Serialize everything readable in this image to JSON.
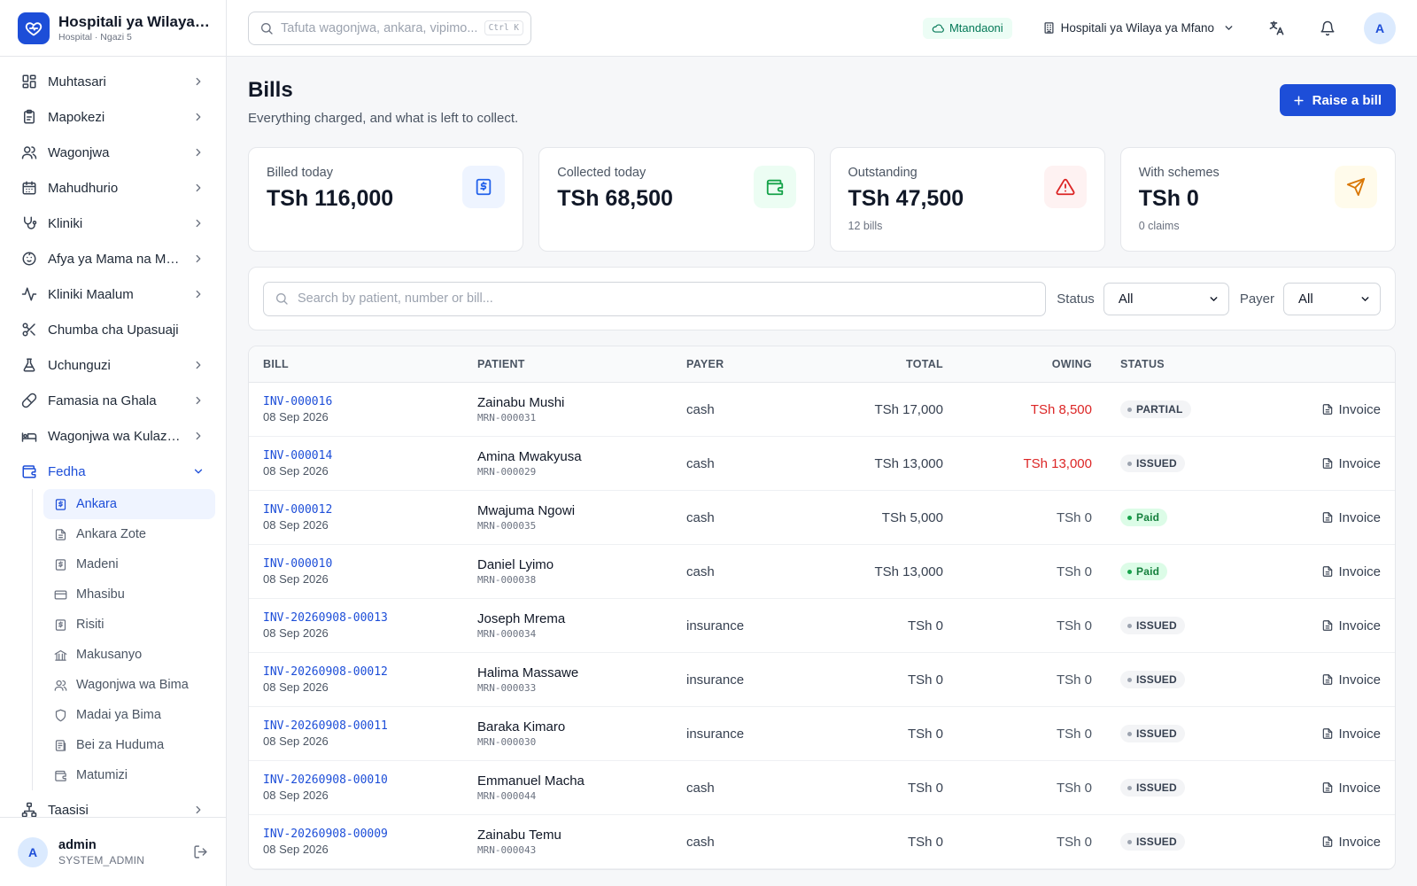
{
  "brand": {
    "name": "Hospitali ya Wilaya ya Mfano",
    "sub": "Hospital · Ngazi 5"
  },
  "nav": {
    "items": [
      {
        "label": "Muhtasari",
        "icon": "dashboard-icon"
      },
      {
        "label": "Mapokezi",
        "icon": "clipboard-icon"
      },
      {
        "label": "Wagonjwa",
        "icon": "users-icon"
      },
      {
        "label": "Mahudhurio",
        "icon": "calendar-icon"
      },
      {
        "label": "Kliniki",
        "icon": "stethoscope-icon"
      },
      {
        "label": "Afya ya Mama na Mtoto",
        "icon": "baby-icon"
      },
      {
        "label": "Kliniki Maalum",
        "icon": "activity-icon"
      },
      {
        "label": "Chumba cha Upasuaji",
        "icon": "scissors-icon"
      },
      {
        "label": "Uchunguzi",
        "icon": "flask-icon"
      },
      {
        "label": "Famasia na Ghala",
        "icon": "pill-icon"
      },
      {
        "label": "Wagonjwa wa Kulazwa",
        "icon": "bed-icon"
      }
    ],
    "finance": {
      "label": "Fedha",
      "icon": "wallet-icon"
    },
    "finance_sub": [
      {
        "label": "Ankara",
        "icon": "receipt-icon"
      },
      {
        "label": "Ankara Zote",
        "icon": "file-icon"
      },
      {
        "label": "Madeni",
        "icon": "receipt-icon"
      },
      {
        "label": "Mhasibu",
        "icon": "card-icon"
      },
      {
        "label": "Risiti",
        "icon": "receipt-icon"
      },
      {
        "label": "Makusanyo",
        "icon": "bank-icon"
      },
      {
        "label": "Wagonjwa wa Bima",
        "icon": "users-icon"
      },
      {
        "label": "Madai ya Bima",
        "icon": "shield-icon"
      },
      {
        "label": "Bei za Huduma",
        "icon": "price-list-icon"
      },
      {
        "label": "Matumizi",
        "icon": "wallet-icon"
      }
    ],
    "after": {
      "label": "Taasisi",
      "icon": "org-icon"
    }
  },
  "user": {
    "initial": "A",
    "name": "admin",
    "role": "SYSTEM_ADMIN"
  },
  "topbar": {
    "search_placeholder": "Tafuta wagonjwa, ankara, vipimo...",
    "shortcut": "Ctrl K",
    "status": "Mtandaoni",
    "facility": "Hospitali ya Wilaya ya Mfano",
    "avatar": "A"
  },
  "page": {
    "title": "Bills",
    "subtitle": "Everything charged, and what is left to collect.",
    "action": "Raise a bill"
  },
  "kpis": [
    {
      "label": "Billed today",
      "value": "TSh 116,000",
      "note": "",
      "icon": "receipt-icon",
      "color": "#2563eb",
      "bg": "#eef4ff"
    },
    {
      "label": "Collected today",
      "value": "TSh 68,500",
      "note": "",
      "icon": "wallet-icon",
      "color": "#16a34a",
      "bg": "#ecfdf3"
    },
    {
      "label": "Outstanding",
      "value": "TSh 47,500",
      "note": "12 bills",
      "icon": "alert-icon",
      "color": "#dc2626",
      "bg": "#fef2f2"
    },
    {
      "label": "With schemes",
      "value": "TSh 0",
      "note": "0 claims",
      "icon": "send-icon",
      "color": "#d97706",
      "bg": "#fffbeb"
    }
  ],
  "filters": {
    "search_placeholder": "Search by patient, number or bill...",
    "status_label": "Status",
    "status_value": "All",
    "payer_label": "Payer",
    "payer_value": "All"
  },
  "table": {
    "headers": {
      "bill": "BILL",
      "patient": "PATIENT",
      "payer": "PAYER",
      "total": "TOTAL",
      "owing": "OWING",
      "status": "STATUS"
    },
    "action_label": "Invoice",
    "rows": [
      {
        "no": "INV-000016",
        "date": "08 Sep 2026",
        "patient": "Zainabu Mushi",
        "mrn": "MRN-000031",
        "payer": "cash",
        "total": "TSh 17,000",
        "owing": "TSh 8,500",
        "owing_due": true,
        "status": "PARTIAL",
        "kind": "gray"
      },
      {
        "no": "INV-000014",
        "date": "08 Sep 2026",
        "patient": "Amina Mwakyusa",
        "mrn": "MRN-000029",
        "payer": "cash",
        "total": "TSh 13,000",
        "owing": "TSh 13,000",
        "owing_due": true,
        "status": "ISSUED",
        "kind": "gray"
      },
      {
        "no": "INV-000012",
        "date": "08 Sep 2026",
        "patient": "Mwajuma Ngowi",
        "mrn": "MRN-000035",
        "payer": "cash",
        "total": "TSh 5,000",
        "owing": "TSh 0",
        "owing_due": false,
        "status": "Paid",
        "kind": "green"
      },
      {
        "no": "INV-000010",
        "date": "08 Sep 2026",
        "patient": "Daniel Lyimo",
        "mrn": "MRN-000038",
        "payer": "cash",
        "total": "TSh 13,000",
        "owing": "TSh 0",
        "owing_due": false,
        "status": "Paid",
        "kind": "green"
      },
      {
        "no": "INV-20260908-00013",
        "date": "08 Sep 2026",
        "patient": "Joseph Mrema",
        "mrn": "MRN-000034",
        "payer": "insurance",
        "total": "TSh 0",
        "owing": "TSh 0",
        "owing_due": false,
        "status": "ISSUED",
        "kind": "gray"
      },
      {
        "no": "INV-20260908-00012",
        "date": "08 Sep 2026",
        "patient": "Halima Massawe",
        "mrn": "MRN-000033",
        "payer": "insurance",
        "total": "TSh 0",
        "owing": "TSh 0",
        "owing_due": false,
        "status": "ISSUED",
        "kind": "gray"
      },
      {
        "no": "INV-20260908-00011",
        "date": "08 Sep 2026",
        "patient": "Baraka Kimaro",
        "mrn": "MRN-000030",
        "payer": "insurance",
        "total": "TSh 0",
        "owing": "TSh 0",
        "owing_due": false,
        "status": "ISSUED",
        "kind": "gray"
      },
      {
        "no": "INV-20260908-00010",
        "date": "08 Sep 2026",
        "patient": "Emmanuel Macha",
        "mrn": "MRN-000044",
        "payer": "cash",
        "total": "TSh 0",
        "owing": "TSh 0",
        "owing_due": false,
        "status": "ISSUED",
        "kind": "gray"
      },
      {
        "no": "INV-20260908-00009",
        "date": "08 Sep 2026",
        "patient": "Zainabu Temu",
        "mrn": "MRN-000043",
        "payer": "cash",
        "total": "TSh 0",
        "owing": "TSh 0",
        "owing_due": false,
        "status": "ISSUED",
        "kind": "gray"
      }
    ]
  }
}
